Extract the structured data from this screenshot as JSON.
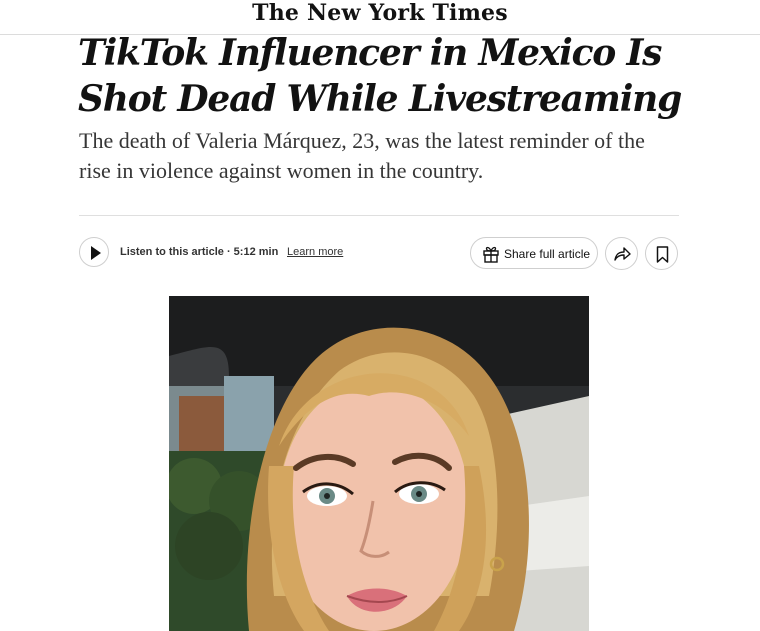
{
  "masthead": {
    "logo_text": "The New York Times"
  },
  "article": {
    "headline": "TikTok Influencer in Mexico Is Shot Dead While Livestreaming",
    "summary": "The death of Valeria Márquez, 23, was the latest reminder of the rise in violence against women in the country."
  },
  "toolbar": {
    "listen_label": "Listen to this article · 5:12 min",
    "learn_more_label": "Learn more",
    "share_label": "Share full article",
    "icons": {
      "play": "play-icon",
      "gift": "gift-icon",
      "forward": "share-arrow-icon",
      "bookmark": "bookmark-icon"
    }
  },
  "colors": {
    "text": "#121212",
    "summary_text": "#363636",
    "border": "#cfcfcf"
  }
}
